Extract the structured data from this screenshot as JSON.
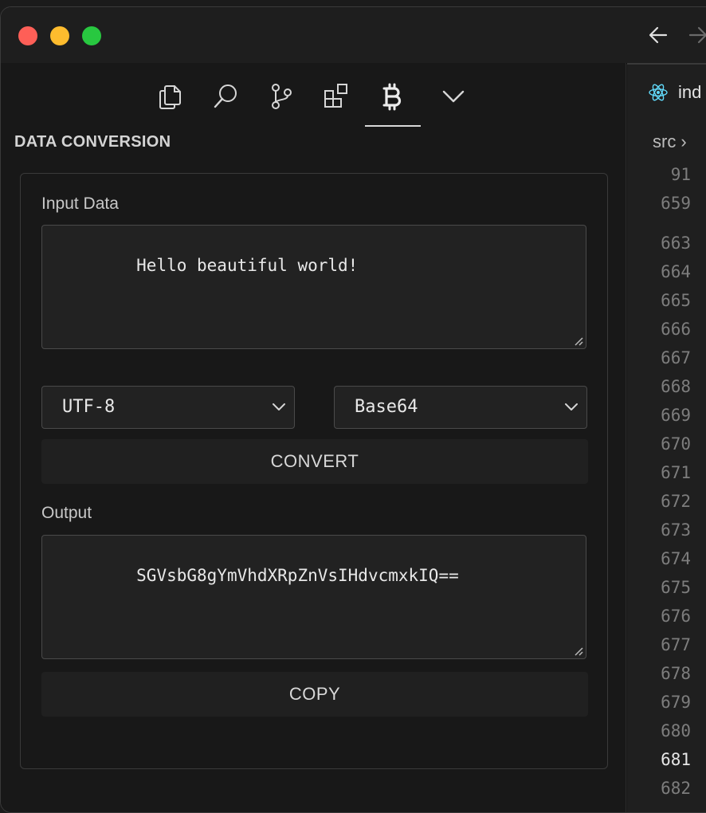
{
  "sidebar": {
    "section_title": "DATA CONVERSION",
    "activity_icons": [
      "copy-icon",
      "search-icon",
      "source-control-icon",
      "extensions-icon",
      "bitcoin-icon",
      "chevron-down-icon"
    ],
    "active_icon": "bitcoin-icon"
  },
  "converter": {
    "input_label": "Input Data",
    "input_value": "Hello beautiful world!",
    "from_encoding": "UTF-8",
    "to_encoding": "Base64",
    "convert_label": "CONVERT",
    "output_label": "Output",
    "output_value": "SGVsbG8gYmVhdXRpZnVsIHdvcmxkIQ==",
    "copy_label": "COPY"
  },
  "editor": {
    "tab_label": "ind",
    "breadcrumb": "src",
    "sticky_lines": [
      "91",
      "659"
    ],
    "line_numbers": [
      "663",
      "664",
      "665",
      "666",
      "667",
      "668",
      "669",
      "670",
      "671",
      "672",
      "673",
      "674",
      "675",
      "676",
      "677",
      "678",
      "679",
      "680",
      "681",
      "682"
    ],
    "current_line": "681"
  },
  "colors": {
    "traffic_red": "#fe5f57",
    "traffic_yellow": "#febc2e",
    "traffic_green": "#28c840",
    "react_blue": "#61dafb"
  }
}
